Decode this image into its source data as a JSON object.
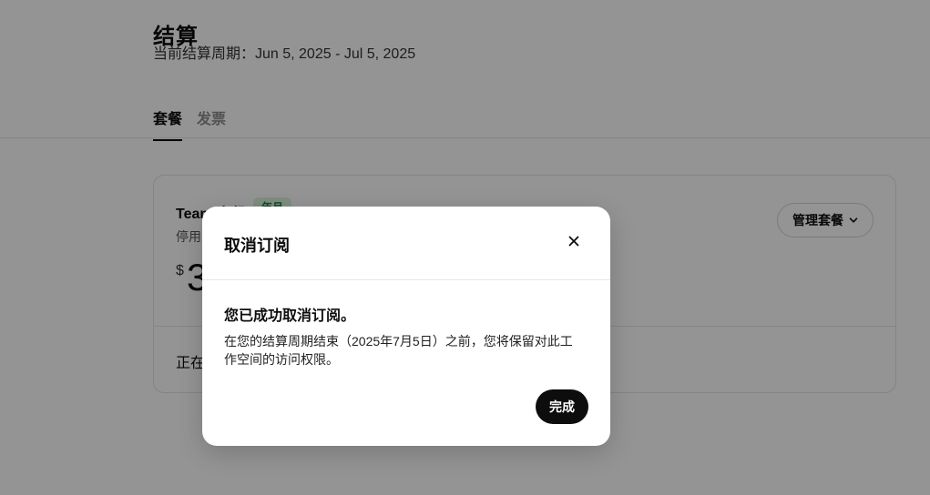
{
  "page": {
    "title": "结算",
    "billing_period": "当前结算周期：Jun 5, 2025 - Jul 5, 2025"
  },
  "tabs": [
    {
      "label": "套餐",
      "active": true
    },
    {
      "label": "发票",
      "active": false
    }
  ],
  "plan_card": {
    "name": "Team 套餐",
    "badge": "年月",
    "status": "停用",
    "currency": "$",
    "price": "3",
    "footer": "正在",
    "manage_button": "管理套餐",
    "badge_color": "#1a7f37"
  },
  "modal": {
    "title": "取消订阅",
    "heading": "您已成功取消订阅。",
    "body": "在您的结算周期结束（2025年7月5日）之前，您将保留对此工作空间的访问权限。",
    "done_button": "完成",
    "close_icon": "close-icon"
  }
}
